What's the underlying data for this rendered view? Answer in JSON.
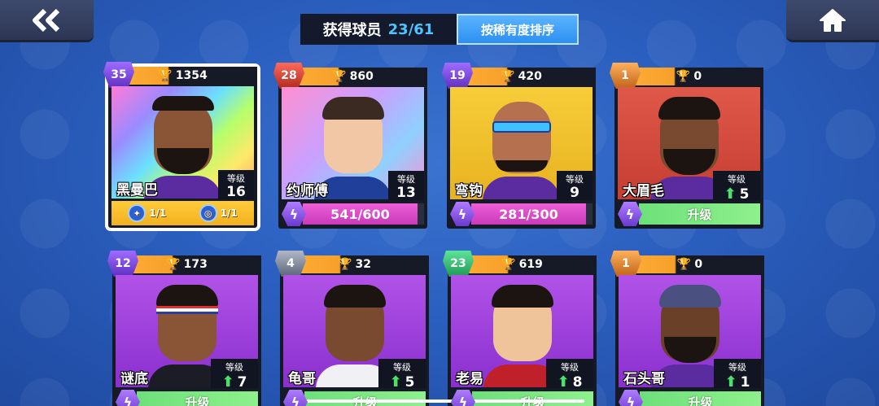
{
  "header": {
    "collected_label": "获得球员",
    "collected_count": "23/61",
    "sort_label": "按稀有度排序"
  },
  "nav": {
    "back_icon": "double-chevron-left-icon",
    "home_icon": "home-icon"
  },
  "labels": {
    "level": "等级",
    "upgrade": "升级"
  },
  "cards": [
    {
      "rank": "35",
      "trophies": "1354",
      "name": "黑曼巴",
      "level": "16",
      "skill1": "1/1",
      "skill2": "1/1"
    },
    {
      "rank": "28",
      "trophies": "860",
      "name": "约师傅",
      "level": "13",
      "progress": "541/600"
    },
    {
      "rank": "19",
      "trophies": "420",
      "name": "弯钩",
      "level": "9",
      "progress": "281/300"
    },
    {
      "rank": "1",
      "trophies": "0",
      "name": "大眉毛",
      "level": "5"
    },
    {
      "rank": "12",
      "trophies": "173",
      "name": "谜底",
      "level": "7"
    },
    {
      "rank": "4",
      "trophies": "32",
      "name": "龟哥",
      "level": "5"
    },
    {
      "rank": "23",
      "trophies": "619",
      "name": "老易",
      "level": "8"
    },
    {
      "rank": "1",
      "trophies": "0",
      "name": "石头哥",
      "level": "1"
    }
  ],
  "colors": {
    "background": "#2b5fbf",
    "sort_button": "#2d8ff0",
    "count_highlight": "#4fc3ff",
    "progress_bar": "#c83ab8",
    "upgrade_bar": "#6de07a"
  }
}
